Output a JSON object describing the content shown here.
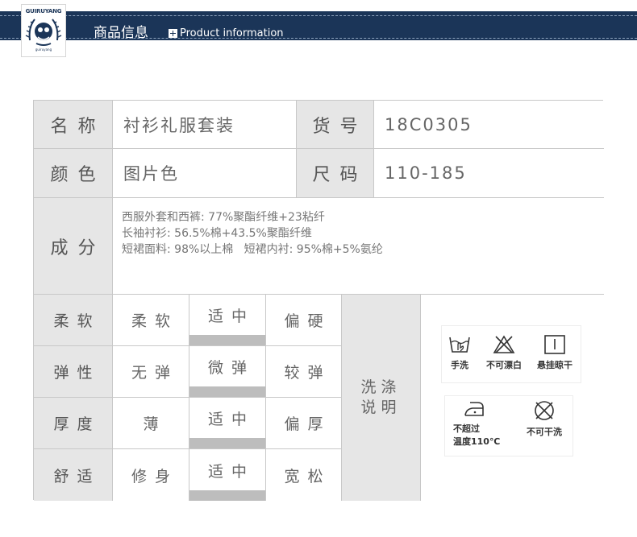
{
  "header": {
    "brand_top": "GUIRUYANG",
    "brand_bottom": "guiruyang",
    "title": "商品信息",
    "subtitle": "Product information"
  },
  "table": {
    "name_label": "名称",
    "name_value": "衬衫礼服套装",
    "sku_label": "货号",
    "sku_value": "18C0305",
    "color_label": "颜色",
    "color_value": "图片色",
    "size_label": "尺码",
    "size_value": "110-185",
    "composition_label": "成分",
    "composition_lines": [
      "西服外套和西裤: 77%聚酯纤维+23粘纤",
      "长袖衬衫: 56.5%棉+43.5%聚酯纤维",
      "短裙面料: 98%以上棉   短裙内衬: 95%棉+5%氨纶"
    ],
    "properties": [
      {
        "label": "柔软",
        "options": [
          "柔软",
          "适中",
          "偏硬"
        ],
        "selected": 1
      },
      {
        "label": "弹性",
        "options": [
          "无弹",
          "微弹",
          "较弹"
        ],
        "selected": 1
      },
      {
        "label": "厚度",
        "options": [
          "薄",
          "适中",
          "偏厚"
        ],
        "selected": 1
      },
      {
        "label": "舒适",
        "options": [
          "修身",
          "适中",
          "宽松"
        ],
        "selected": 1
      }
    ],
    "wash_label_1": "洗涤",
    "wash_label_2": "说明",
    "wash_icons": [
      {
        "name": "hand-wash-icon",
        "label": "手洗"
      },
      {
        "name": "no-bleach-icon",
        "label": "不可漂白"
      },
      {
        "name": "hang-dry-icon",
        "label": "悬挂晾干"
      },
      {
        "name": "iron-icon",
        "label_1": "不超过",
        "label_2": "温度110℃"
      },
      {
        "name": "no-dry-clean-icon",
        "label": "不可干洗"
      }
    ]
  }
}
